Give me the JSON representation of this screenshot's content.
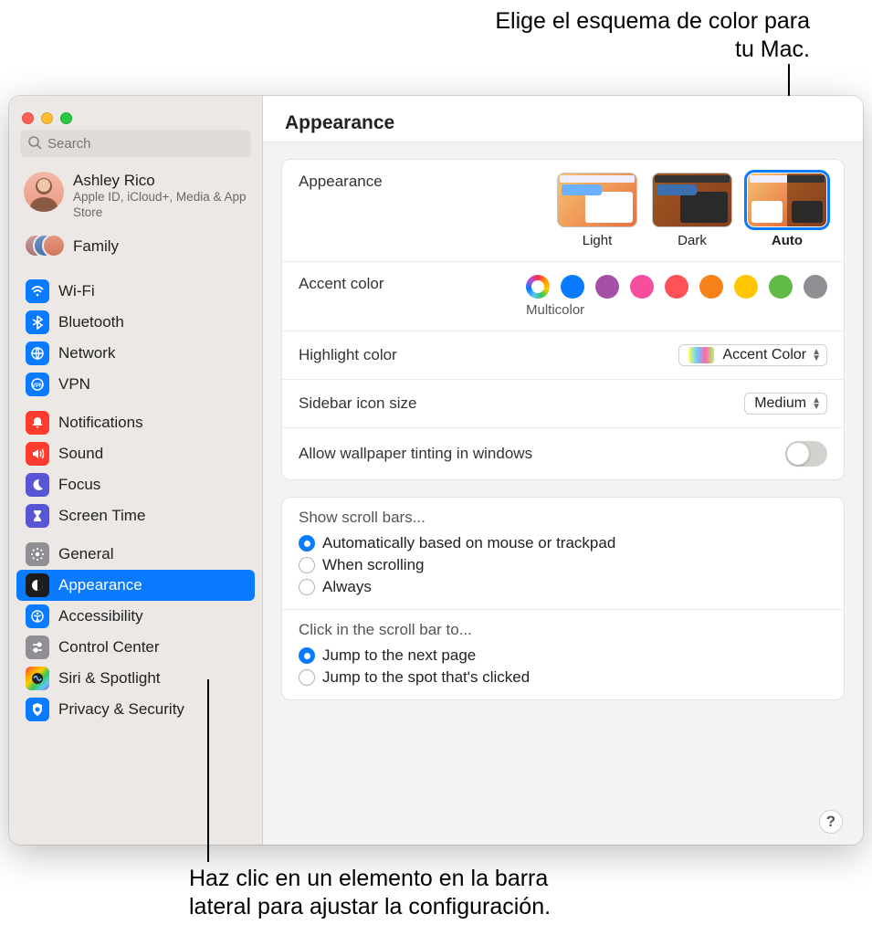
{
  "callouts": {
    "top": "Elige el esquema de color para tu Mac.",
    "bottom": "Haz clic en un elemento en la barra lateral para ajustar la configuración."
  },
  "page_title": "Appearance",
  "search": {
    "placeholder": "Search"
  },
  "account": {
    "name": "Ashley Rico",
    "sub": "Apple ID, iCloud+, Media & App Store"
  },
  "family_label": "Family",
  "sidebar_groups": [
    {
      "items": [
        {
          "label": "Wi-Fi",
          "icon": "wifi",
          "bg": "ic-blue"
        },
        {
          "label": "Bluetooth",
          "icon": "bluetooth",
          "bg": "ic-blue"
        },
        {
          "label": "Network",
          "icon": "network",
          "bg": "ic-blue"
        },
        {
          "label": "VPN",
          "icon": "vpn",
          "bg": "ic-blue"
        }
      ]
    },
    {
      "items": [
        {
          "label": "Notifications",
          "icon": "bell",
          "bg": "ic-red"
        },
        {
          "label": "Sound",
          "icon": "sound",
          "bg": "ic-red"
        },
        {
          "label": "Focus",
          "icon": "moon",
          "bg": "ic-purple"
        },
        {
          "label": "Screen Time",
          "icon": "hourglass",
          "bg": "ic-purple"
        }
      ]
    },
    {
      "items": [
        {
          "label": "General",
          "icon": "gear",
          "bg": "ic-gray"
        },
        {
          "label": "Appearance",
          "icon": "appearance",
          "bg": "ic-black",
          "selected": true
        },
        {
          "label": "Accessibility",
          "icon": "accessibility",
          "bg": "ic-blue"
        },
        {
          "label": "Control Center",
          "icon": "control-center",
          "bg": "ic-gray"
        },
        {
          "label": "Siri & Spotlight",
          "icon": "siri",
          "bg": "ic-rainbow"
        },
        {
          "label": "Privacy & Security",
          "icon": "privacy",
          "bg": "ic-blue"
        }
      ]
    }
  ],
  "appearance": {
    "section_label": "Appearance",
    "options": [
      "Light",
      "Dark",
      "Auto"
    ],
    "selected": "Auto"
  },
  "accent": {
    "label": "Accent color",
    "selected_label": "Multicolor",
    "colors": [
      "multicolor",
      "#0a7bff",
      "#a550a7",
      "#f74f9e",
      "#ff5257",
      "#f7821b",
      "#ffc600",
      "#62ba46",
      "#8e8e93"
    ]
  },
  "highlight": {
    "label": "Highlight color",
    "value": "Accent Color"
  },
  "sidebar_icon": {
    "label": "Sidebar icon size",
    "value": "Medium"
  },
  "tinting": {
    "label": "Allow wallpaper tinting in windows",
    "on": false
  },
  "scrollbars": {
    "title": "Show scroll bars...",
    "options": [
      "Automatically based on mouse or trackpad",
      "When scrolling",
      "Always"
    ],
    "selected": 0
  },
  "click_scroll": {
    "title": "Click in the scroll bar to...",
    "options": [
      "Jump to the next page",
      "Jump to the spot that's clicked"
    ],
    "selected": 0
  },
  "help": "?"
}
